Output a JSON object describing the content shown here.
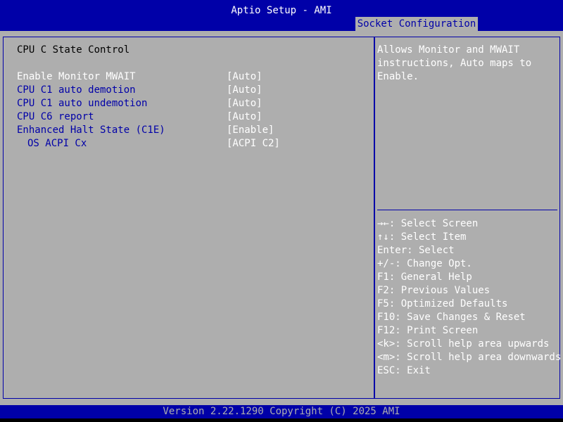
{
  "header": {
    "title": "Aptio Setup - AMI",
    "active_tab": "Socket Configuration"
  },
  "main": {
    "section_title": "CPU C State Control",
    "options": [
      {
        "label": "Enable Monitor MWAIT",
        "value": "[Auto]"
      },
      {
        "label": "CPU C1 auto demotion",
        "value": "[Auto]"
      },
      {
        "label": "CPU C1 auto undemotion",
        "value": "[Auto]"
      },
      {
        "label": "CPU C6 report",
        "value": "[Auto]"
      },
      {
        "label": "Enhanced Halt State (C1E)",
        "value": "[Enable]"
      },
      {
        "label": "OS ACPI Cx",
        "value": "[ACPI C2]"
      }
    ]
  },
  "help": {
    "description": "Allows Monitor and MWAIT instructions, Auto maps to Enable.",
    "keys": [
      "→←: Select Screen",
      "↑↓: Select Item",
      "Enter: Select",
      "+/-: Change Opt.",
      "F1: General Help",
      "F2: Previous Values",
      "F5: Optimized Defaults",
      "F10: Save Changes & Reset",
      "F12: Print Screen",
      "<k>: Scroll help area upwards",
      "<m>: Scroll help area downwards",
      "ESC: Exit"
    ]
  },
  "footer": {
    "version": "Version 2.22.1290 Copyright (C) 2025 AMI"
  },
  "colors": {
    "bar_blue": "#0000a8",
    "panel_gray": "#aeaeae",
    "highlight_white": "#ffffff"
  }
}
